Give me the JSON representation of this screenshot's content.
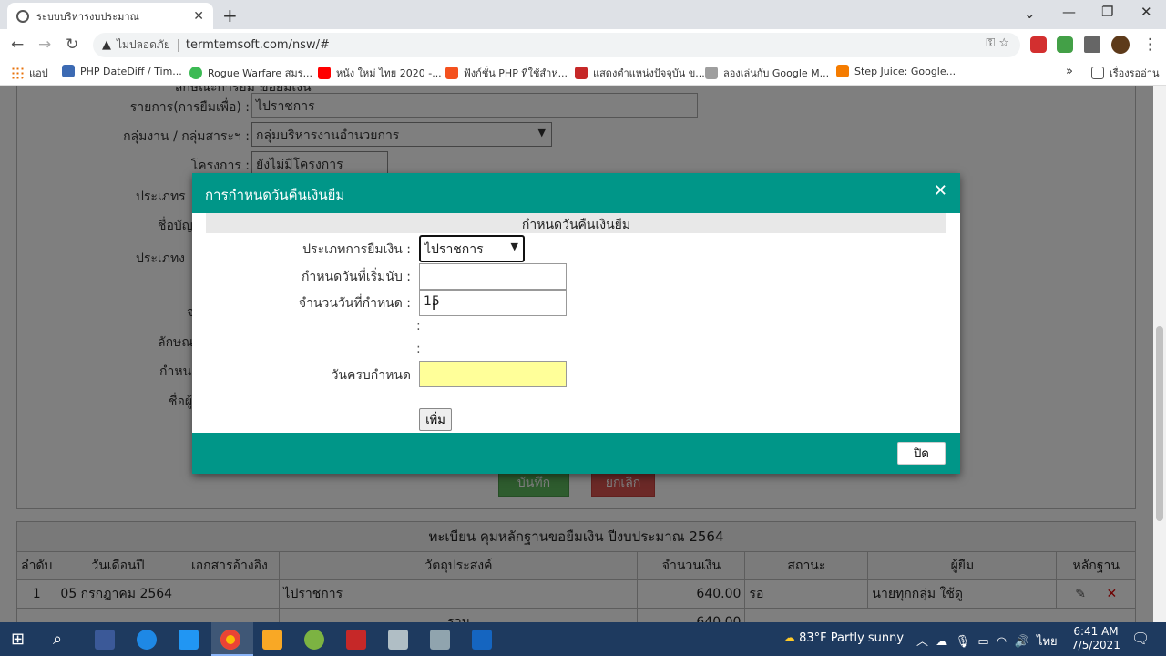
{
  "browser": {
    "tab_title": "ระบบบริหารงบประมาณ",
    "insecure_label": "ไม่ปลอดภัย",
    "url": "termtemsoft.com/nsw/#",
    "bookmarks": [
      {
        "label": "แอป",
        "color": "#e8710a"
      },
      {
        "label": "PHP DateDiff / Tim...",
        "color": "#3c6ab3"
      },
      {
        "label": "Rogue Warfare สมร...",
        "color": "#3cba54"
      },
      {
        "label": "หนัง ใหม่ ไทย 2020 -...",
        "color": "#ff0000"
      },
      {
        "label": "ฟังก์ชั่น PHP ที่ใช้สำห...",
        "color": "#f4511e"
      },
      {
        "label": "แสดงตำแหน่งปัจจุบัน ข...",
        "color": "#c62828"
      },
      {
        "label": "ลองเล่นกับ Google M...",
        "color": "#9e9e9e"
      },
      {
        "label": "Step Juice: Google...",
        "color": "#f57c00"
      }
    ],
    "reading_list": "เรื่องรออ่าน"
  },
  "form": {
    "top_label_partial": "ลักษณะการยืม :",
    "top_radio_partial": "ขอยืมเงิน",
    "item_label": "รายการ(การยืมเพื่อ) :",
    "item_value": "ไปราชการ",
    "group_label": "กลุ่มงาน / กลุ่มสาระฯ :",
    "group_value": "กลุ่มบริหารงานอำนวยการ",
    "project_label": "โครงการ :",
    "project_value": "ยังไม่มีโครงการ",
    "hidden_labels": [
      "ประเภทร",
      "ชื่อบัญ",
      "ประเภทง",
      "จ",
      "ลักษณ",
      "กำหน",
      "ชื่อผู้"
    ],
    "save_label": "บันทึก",
    "cancel_label": "ยกเลิก"
  },
  "register": {
    "caption": "ทะเบียน คุมหลักฐานขอยืมเงิน ปีงบประมาณ 2564",
    "headers": [
      "ลำดับ",
      "วันเดือนปี",
      "เอกสารอ้างอิง",
      "วัตถุประสงค์",
      "จำนวนเงิน",
      "สถานะ",
      "ผู้ยืม",
      "หลักฐาน"
    ],
    "rows": [
      [
        "1",
        "05 กรกฎาคม 2564",
        "",
        "ไปราชการ",
        "640.00",
        "รอ",
        "นายทุกกลุ่ม ใช้ดู"
      ]
    ],
    "total_label": "รวม",
    "total_value": "640.00"
  },
  "modal": {
    "title": "การกำหนดวันคืนเงินยืม",
    "section": "กำหนดวันคืนเงินยืม",
    "type_label": "ประเภทการยืมเงิน :",
    "type_value": "ไปราชการ",
    "start_label": "กำหนดวันที่เริ่มนับ :",
    "start_value": "",
    "days_label": "จำนวนวันที่กำหนด :",
    "days_value": "15",
    "colon": ":",
    "due_label": "วันครบกำหนด",
    "due_value": "",
    "add_label": "เพิ่ม",
    "close_label": "ปิด"
  },
  "taskbar": {
    "weather": "83°F  Partly sunny",
    "lang": "ไทย",
    "time": "6:41 AM",
    "date": "7/5/2021"
  }
}
